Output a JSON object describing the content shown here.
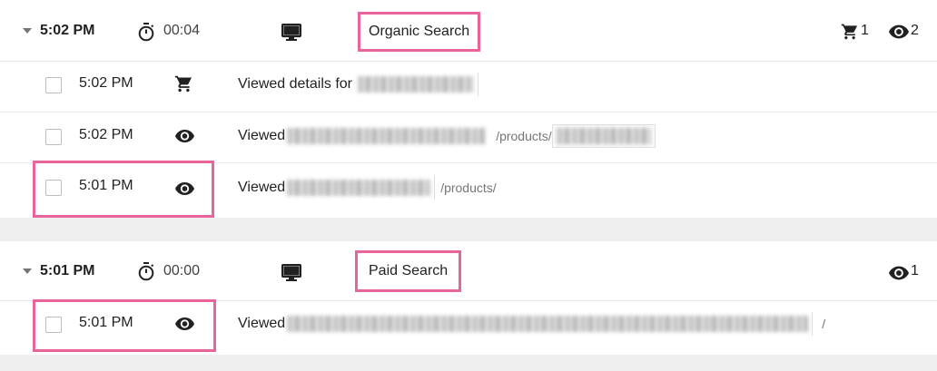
{
  "sessions": [
    {
      "time": "5:02 PM",
      "duration": "00:04",
      "device_icon": "desktop-icon",
      "source": "Organic Search",
      "cart_count": "1",
      "view_count": "2",
      "events": [
        {
          "time": "5:02 PM",
          "icon": "cart-icon",
          "description": "Viewed details for",
          "path": ""
        },
        {
          "time": "5:02 PM",
          "icon": "eye-icon",
          "description": "Viewed",
          "path": "/products/"
        },
        {
          "time": "5:01 PM",
          "icon": "eye-icon",
          "description": "Viewed",
          "path": "/products/"
        }
      ]
    },
    {
      "time": "5:01 PM",
      "duration": "00:00",
      "device_icon": "desktop-icon",
      "source": "Paid Search",
      "view_count": "1",
      "events": [
        {
          "time": "5:01 PM",
          "icon": "eye-icon",
          "description": "Viewed",
          "path": "/"
        }
      ]
    }
  ],
  "colors": {
    "highlight": "#e8649a",
    "background": "#efefef"
  }
}
